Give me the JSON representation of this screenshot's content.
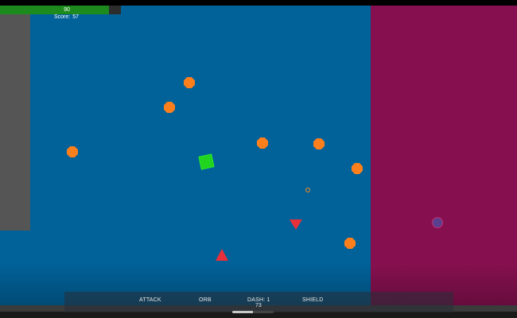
{
  "player": {
    "health": 90,
    "health_max": 100,
    "health_text": "90",
    "score_label": "Score:",
    "score_value": "57",
    "color": "#21d41f"
  },
  "colors": {
    "arena": "#01629a",
    "wall": "#555555",
    "hazard_zone": "#86104f",
    "enemy": "#ff7f1d",
    "spike": "#e8303a",
    "health_fill": "#1d8a1d"
  },
  "entities": {
    "enemies": [
      {
        "shape": "octagon"
      },
      {
        "shape": "octagon"
      },
      {
        "shape": "octagon"
      },
      {
        "shape": "octagon"
      },
      {
        "shape": "octagon"
      },
      {
        "shape": "octagon"
      },
      {
        "shape": "octagon"
      }
    ],
    "spikes": [
      {
        "shape": "triangle",
        "direction": "down"
      },
      {
        "shape": "triangle",
        "direction": "up"
      }
    ],
    "pickups": [
      {
        "icon": "small-orange-ring"
      }
    ],
    "orbs": [
      {
        "icon": "purple-orb"
      }
    ]
  },
  "hud": {
    "abilities": [
      {
        "label": "ATTACK"
      },
      {
        "label": "ORB"
      },
      {
        "label": "DASH: 1"
      },
      {
        "label": "SHIELD"
      }
    ],
    "timer": "73",
    "progress_fraction": 0.5
  }
}
